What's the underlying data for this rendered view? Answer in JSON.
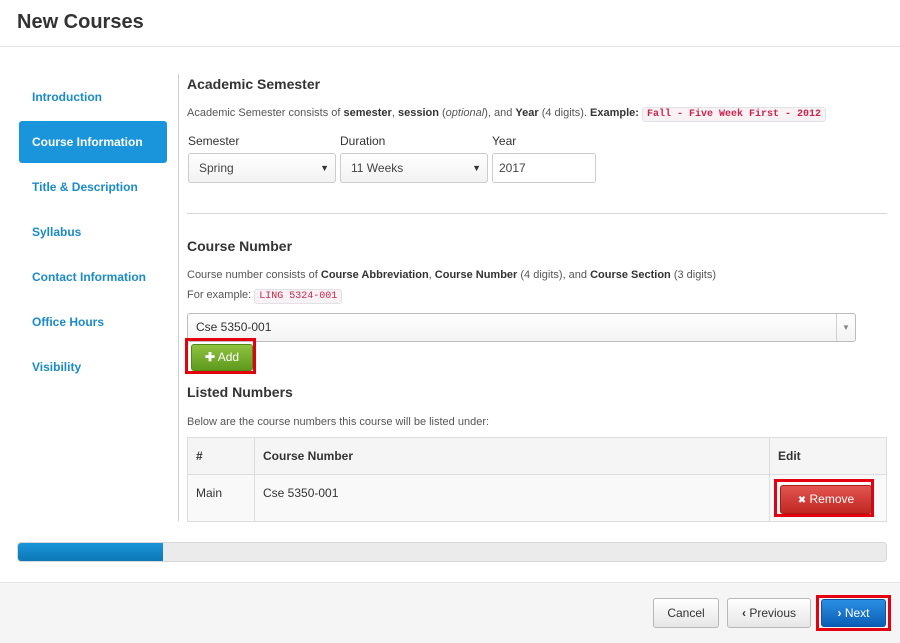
{
  "header": {
    "title": "New Courses"
  },
  "sidebar": {
    "items": [
      {
        "label": "Introduction"
      },
      {
        "label": "Course Information"
      },
      {
        "label": "Title & Description"
      },
      {
        "label": "Syllabus"
      },
      {
        "label": "Contact Information"
      },
      {
        "label": "Office Hours"
      },
      {
        "label": "Visibility"
      }
    ],
    "active_index": 1
  },
  "semester_section": {
    "title": "Academic Semester",
    "help_prefix": "Academic Semester consists of ",
    "help_b1": "semester",
    "help_sep1": ", ",
    "help_b2": "session",
    "help_paren_open": " (",
    "help_optional": "optional",
    "help_paren_close": "), and ",
    "help_b3": "Year",
    "help_suffix": " (4 digits). ",
    "example_label": "Example:",
    "example_code": "Fall - Five Week First - 2012",
    "semester_label": "Semester",
    "semester_value": "Spring",
    "duration_label": "Duration",
    "duration_value": "11 Weeks",
    "year_label": "Year",
    "year_value": "2017"
  },
  "course_number_section": {
    "title": "Course Number",
    "help_prefix": "Course number consists of ",
    "help_b1": "Course Abbreviation",
    "help_sep1": ", ",
    "help_b2": "Course Number",
    "help_mid": " (4 digits), and ",
    "help_b3": "Course Section",
    "help_suffix": " (3 digits)",
    "example_label": "For example:",
    "example_code": "LING 5324-001",
    "combo_value": "Cse 5350-001",
    "add_label": "Add"
  },
  "listed_section": {
    "title": "Listed Numbers",
    "help": "Below are the course numbers this course will be listed under:",
    "columns": [
      "#",
      "Course Number",
      "Edit"
    ],
    "rows": [
      {
        "type": "Main",
        "number": "Cse 5350-001",
        "action": "Remove"
      }
    ]
  },
  "progress": {
    "percent": 16.7
  },
  "footer": {
    "cancel_label": "Cancel",
    "previous_label": "Previous",
    "next_label": "Next"
  },
  "colors": {
    "accent": "#1a94da",
    "success": "#6aa82a",
    "danger": "#d0342f",
    "highlight": "#e3000f"
  }
}
